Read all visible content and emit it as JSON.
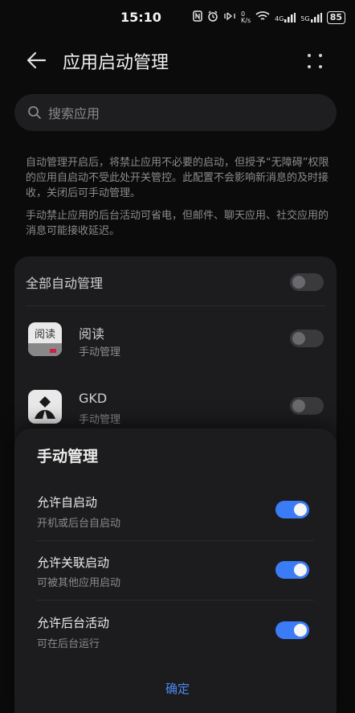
{
  "status_bar": {
    "time": "15:10",
    "net_speed_top": "0",
    "net_speed_unit": "K/s",
    "net1": "4G",
    "net2": "5G",
    "battery": "85"
  },
  "header": {
    "title": "应用启动管理"
  },
  "search": {
    "placeholder": "搜索应用"
  },
  "description": {
    "p1": "自动管理开启后，将禁止应用不必要的启动，但授予“无障碍”权限的应用自启动不受此处开关管控。此配置不会影响新消息的及时接收，关闭后可手动管理。",
    "p2": "手动禁止应用的后台活动可省电，但邮件、聊天应用、社交应用的消息可能接收延迟。"
  },
  "card": {
    "all_label": "全部自动管理",
    "all_toggle_on": false,
    "apps": [
      {
        "name": "阅读",
        "status": "手动管理",
        "toggle_on": false,
        "icon_text": "阅读"
      },
      {
        "name": "GKD",
        "status": "手动管理",
        "toggle_on": false
      }
    ]
  },
  "sheet": {
    "title": "手动管理",
    "options": [
      {
        "label": "允许自启动",
        "sub": "开机或后台自启动",
        "on": true
      },
      {
        "label": "允许关联启动",
        "sub": "可被其他应用启动",
        "on": true
      },
      {
        "label": "允许后台活动",
        "sub": "可在后台运行",
        "on": true
      }
    ],
    "confirm": "确定"
  },
  "colors": {
    "accent": "#3b7cf6",
    "background": "#0b0b0b",
    "card": "#1c1c1e"
  }
}
